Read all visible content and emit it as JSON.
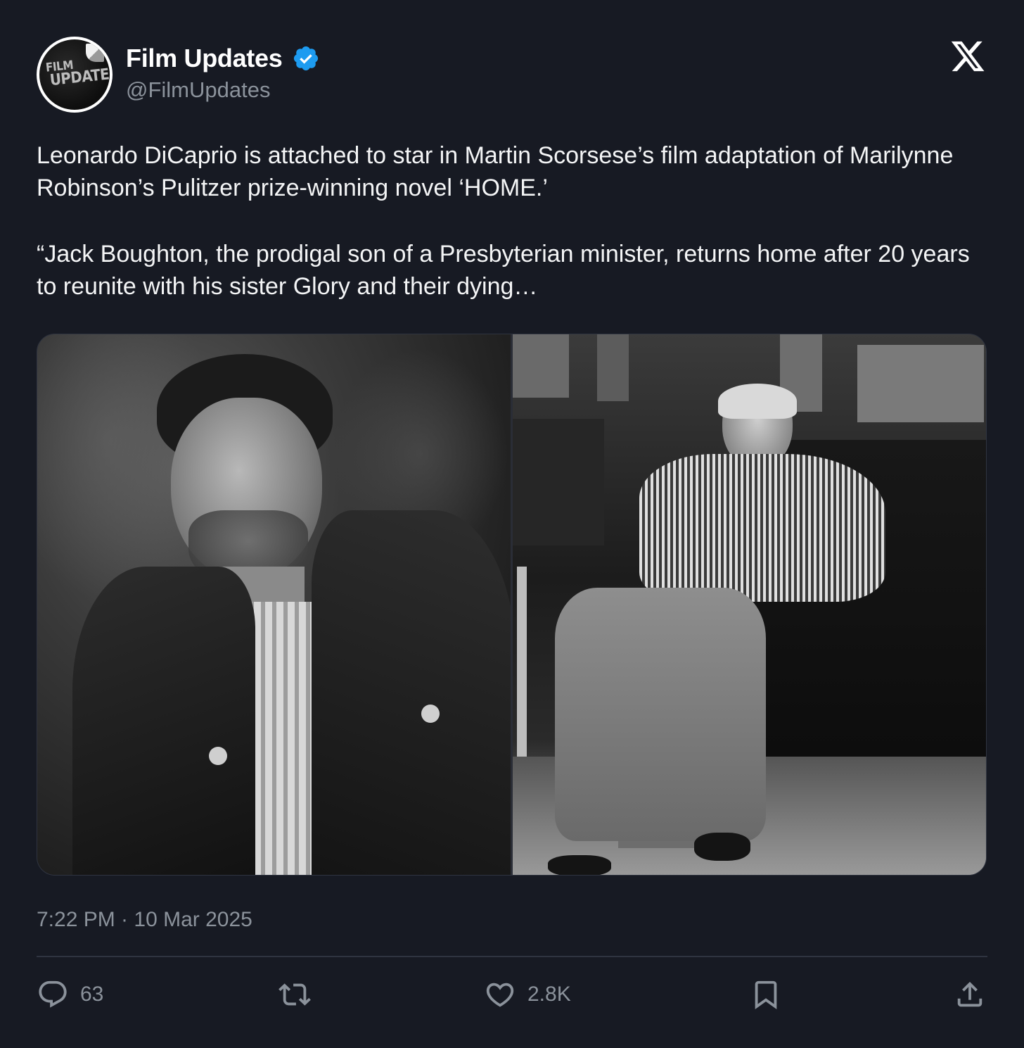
{
  "author": {
    "display_name": "Film Updates",
    "handle": "@FilmUpdates",
    "verified": true,
    "avatar_text_line1": "FILM",
    "avatar_text_line2": "UPDATES"
  },
  "platform": {
    "logo_icon": "x-logo-icon"
  },
  "tweet": {
    "paragraph1": "Leonardo DiCaprio is attached to star in Martin Scorsese’s film adaptation of Marilynne Robinson’s Pulitzer prize-winning novel ‘HOME.’",
    "paragraph2": "“Jack Boughton, the prodigal son of a Presbyterian minister, returns home after 20 years to reunite with his sister Glory and their dying…",
    "timestamp": "7:22 PM · 10 Mar 2025"
  },
  "media": {
    "photos": [
      {
        "name": "photo-left",
        "kind": "black-and-white portrait"
      },
      {
        "name": "photo-right",
        "kind": "black-and-white candid"
      }
    ]
  },
  "actions": {
    "reply": {
      "icon": "reply-icon",
      "count": "63"
    },
    "repost": {
      "icon": "repost-icon",
      "count": ""
    },
    "like": {
      "icon": "heart-icon",
      "count": "2.8K"
    },
    "bookmark": {
      "icon": "bookmark-icon"
    },
    "share": {
      "icon": "share-icon"
    }
  },
  "colors": {
    "background": "#171a23",
    "text": "#f4f5f6",
    "muted": "#8b929b",
    "verified": "#1d9bf0",
    "divider": "#2f3440"
  }
}
